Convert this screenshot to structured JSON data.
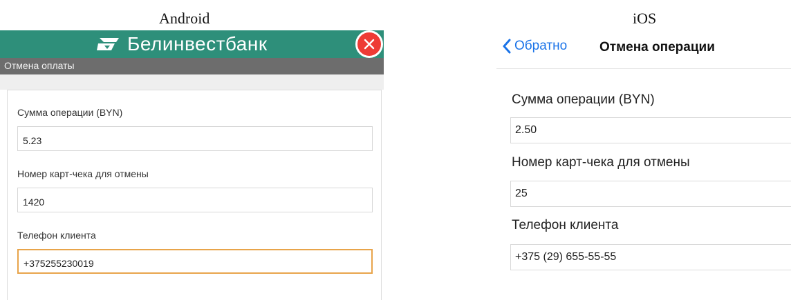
{
  "labels": {
    "android": "Android",
    "ios": "iOS"
  },
  "android": {
    "bank_name": "Белинвестбанк",
    "screen_title": "Отмена оплаты",
    "fields": [
      {
        "label": "Сумма операции (BYN)",
        "value": "5.23"
      },
      {
        "label": "Номер карт-чека для отмены",
        "value": "1420"
      },
      {
        "label": "Телефон клиента",
        "value": "+375255230019"
      }
    ],
    "colors": {
      "topbar": "#2e8f7a",
      "subbar": "#6d6d6d",
      "close": "#ee3b35",
      "focus": "#e8a44a"
    },
    "icons": {
      "logo": "bank-logo-icon",
      "close": "close-icon"
    }
  },
  "ios": {
    "back_label": "Обратно",
    "title": "Отмена операции",
    "fields": [
      {
        "label": "Сумма операции (BYN)",
        "value": "2.50"
      },
      {
        "label": "Номер карт-чека для отмены",
        "value": "25"
      },
      {
        "label": "Телефон клиента",
        "value": "+375 (29) 655-55-55"
      }
    ],
    "colors": {
      "accent": "#1a73e8"
    },
    "icons": {
      "back": "chevron-left-icon"
    }
  }
}
